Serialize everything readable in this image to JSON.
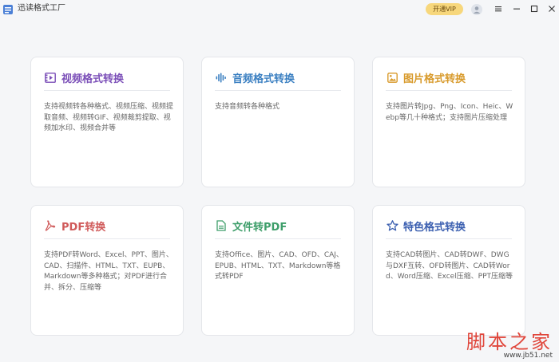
{
  "app": {
    "title": "迅读格式工厂",
    "vip_label": "开通VIP"
  },
  "cards": [
    {
      "title": "视频格式转换",
      "desc": "支持视频转各种格式、视频压缩、视频提取音频、视频转GIF、视频裁剪提取、视频加水印、视频合并等",
      "color": "#7b4fb8",
      "icon": "video-icon"
    },
    {
      "title": "音频格式转换",
      "desc": "支持音频转各种格式",
      "color": "#3a7fc1",
      "icon": "audio-wave-icon"
    },
    {
      "title": "图片格式转换",
      "desc": "支持图片转Jpg、Png、Icon、Heic、Webp等几十种格式；支持图片压缩处理",
      "color": "#d89a2b",
      "icon": "image-icon"
    },
    {
      "title": "PDF转换",
      "desc": "支持PDF转Word、Excel、PPT、图片、CAD、扫描件、HTML、TXT、EUPB、Markdown等多种格式；对PDF进行合并、拆分、压缩等",
      "color": "#d05a5a",
      "icon": "pdf-icon"
    },
    {
      "title": "文件转PDF",
      "desc": "支持Office、图片、CAD、OFD、CAJ、EPUB、HTML、TXT、Markdown等格式转PDF",
      "color": "#3e9e6a",
      "icon": "document-icon"
    },
    {
      "title": "特色格式转换",
      "desc": "支持CAD转图片、CAD转DWF、DWG与DXF互转、OFD转图片、CAD转Word、Word压缩、Excel压缩、PPT压缩等",
      "color": "#3b5fb0",
      "icon": "star-icon"
    }
  ],
  "watermark": {
    "text": "脚本之家",
    "url": "www.jb51.net"
  }
}
